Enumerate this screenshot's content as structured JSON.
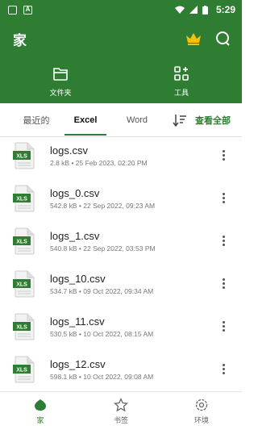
{
  "status": {
    "time": "5:29"
  },
  "header": {
    "title": "家"
  },
  "header_nav": [
    {
      "label": "文件夹",
      "icon": "folder-icon"
    },
    {
      "label": "工具",
      "icon": "tools-icon"
    }
  ],
  "tabs": [
    {
      "label": "最近的"
    },
    {
      "label": "Excel"
    },
    {
      "label": "Word"
    }
  ],
  "view_all": "查看全部",
  "files": [
    {
      "name": "logs.csv",
      "meta": "2.8 kB • 25 Feb 2023, 02:20 PM"
    },
    {
      "name": "logs_0.csv",
      "meta": "542.8 kB • 22 Sep 2022, 09:23 AM"
    },
    {
      "name": "logs_1.csv",
      "meta": "540.8 kB • 22 Sep 2022, 03:53 PM"
    },
    {
      "name": "logs_10.csv",
      "meta": "534.7 kB • 09 Oct 2022, 09:34 AM"
    },
    {
      "name": "logs_11.csv",
      "meta": "530.5 kB • 10 Oct 2022, 08:15 AM"
    },
    {
      "name": "logs_12.csv",
      "meta": "598.1 kB • 10 Oct 2022, 09:08 AM"
    }
  ],
  "file_icon_label": "XLS",
  "bottom_nav": [
    {
      "label": "家",
      "icon": "home-icon"
    },
    {
      "label": "书签",
      "icon": "star-icon"
    },
    {
      "label": "环境",
      "icon": "settings-icon"
    }
  ],
  "colors": {
    "primary": "#2e7d32",
    "crown": "#f4c20d"
  }
}
